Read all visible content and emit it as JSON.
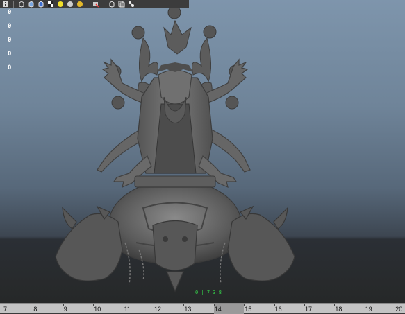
{
  "toolbar": {
    "icons": [
      "info-icon",
      "cube-wireframe-icon",
      "cube-shaded-icon",
      "cube-textured-icon",
      "checker-icon",
      "light-bulb-icon",
      "default-light-icon",
      "all-lights-icon",
      "render-icon",
      "camera-icon",
      "display-layer-icon",
      "snapshot-icon"
    ]
  },
  "hud": {
    "values": [
      "0",
      "0",
      "0",
      "0",
      "0"
    ]
  },
  "viewport": {
    "frame_marker": "0 | 7 3 8"
  },
  "timeline": {
    "labels": [
      "7",
      "8",
      "9",
      "10",
      "11",
      "12",
      "13",
      "14",
      "15",
      "16",
      "17",
      "18",
      "19",
      "20"
    ],
    "current_frame": "14"
  },
  "colors": {
    "gradient_top": "#7e95ac",
    "gradient_bottom": "#3d4651",
    "floor": "#262828",
    "model": "#5f5f5f",
    "timeline_bg": "#c4c4c4",
    "frame_marker": "#35d14a"
  }
}
